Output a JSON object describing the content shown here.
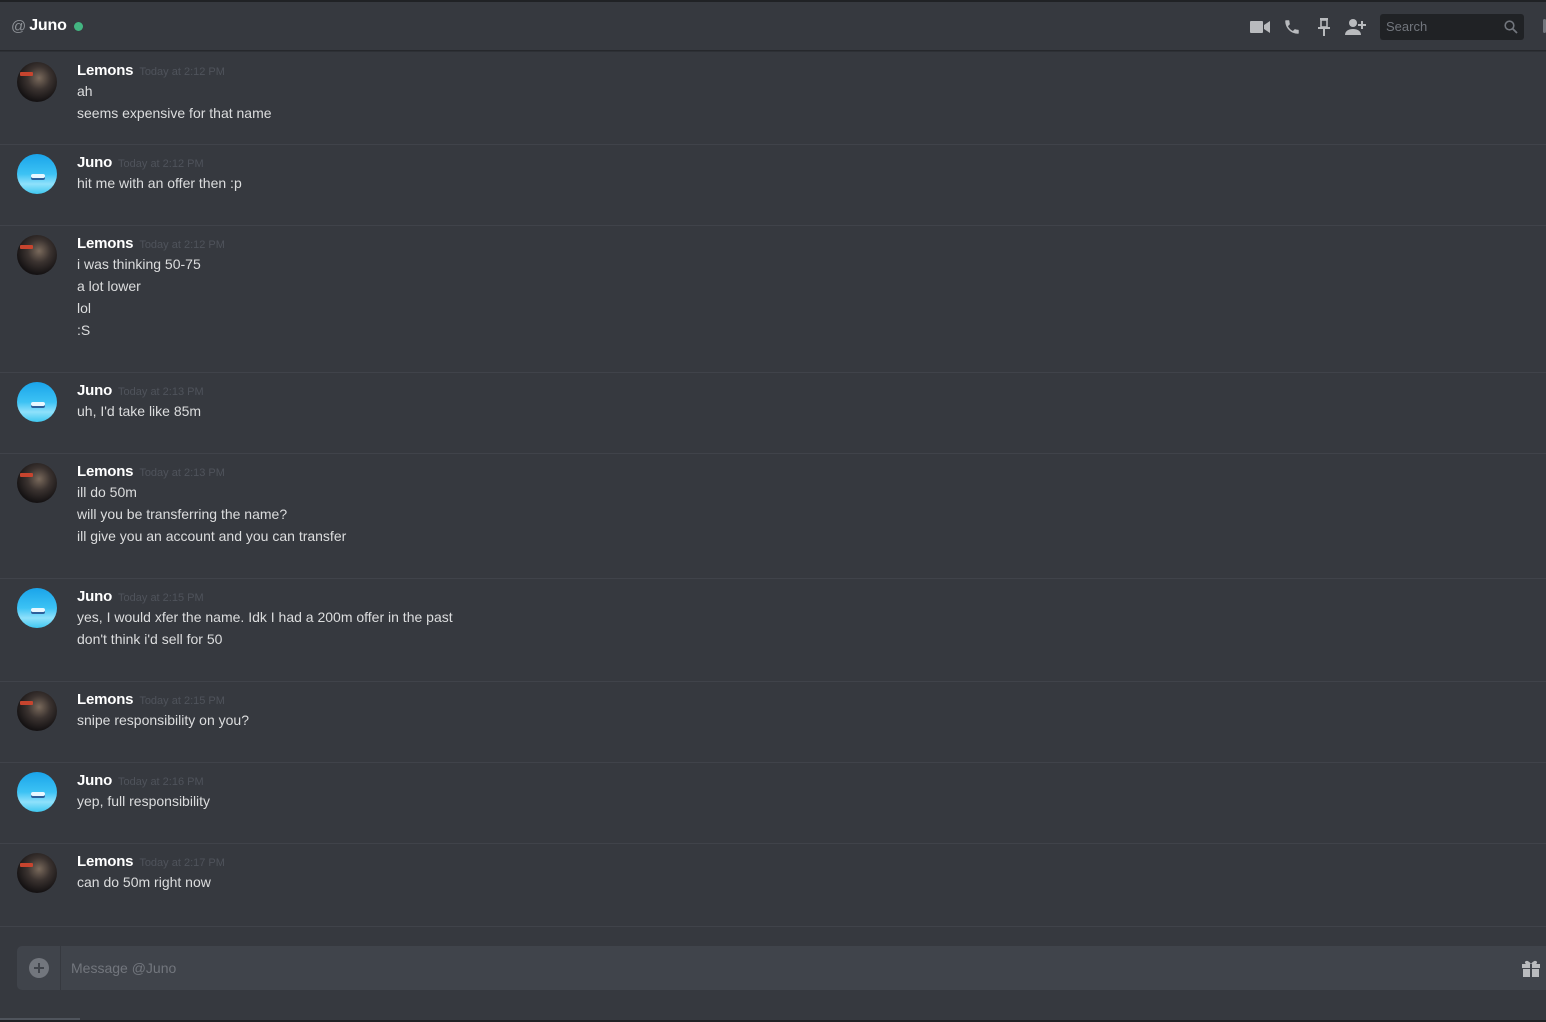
{
  "header": {
    "at_symbol": "@",
    "name": "Juno",
    "status": "online",
    "status_color": "#43b581",
    "icons": [
      "video-call-icon",
      "voice-call-icon",
      "pin-icon",
      "add-friend-icon"
    ],
    "search_placeholder": "Search"
  },
  "messages": [
    {
      "author": "Lemons",
      "avatar": "lemons-avatar",
      "timestamp": "Today at 2:12 PM",
      "lines": [
        "ah",
        "seems expensive for that name"
      ]
    },
    {
      "author": "Juno",
      "avatar": "juno-avatar",
      "timestamp": "Today at 2:12 PM",
      "lines": [
        "hit me with an offer then :p"
      ]
    },
    {
      "author": "Lemons",
      "avatar": "lemons-avatar",
      "timestamp": "Today at 2:12 PM",
      "lines": [
        "i was thinking 50-75",
        "a lot lower",
        "lol",
        ":S"
      ]
    },
    {
      "author": "Juno",
      "avatar": "juno-avatar",
      "timestamp": "Today at 2:13 PM",
      "lines": [
        "uh, I'd take like 85m"
      ]
    },
    {
      "author": "Lemons",
      "avatar": "lemons-avatar",
      "timestamp": "Today at 2:13 PM",
      "lines": [
        "ill do 50m",
        "will you be transferring the name?",
        "ill give you an account and you can transfer"
      ]
    },
    {
      "author": "Juno",
      "avatar": "juno-avatar",
      "timestamp": "Today at 2:15 PM",
      "lines": [
        "yes, I would xfer the name. Idk I had a 200m offer in the past",
        "don't think i'd sell for 50"
      ]
    },
    {
      "author": "Lemons",
      "avatar": "lemons-avatar",
      "timestamp": "Today at 2:15 PM",
      "lines": [
        "snipe responsibility on you?"
      ]
    },
    {
      "author": "Juno",
      "avatar": "juno-avatar",
      "timestamp": "Today at 2:16 PM",
      "lines": [
        "yep, full responsibility"
      ]
    },
    {
      "author": "Lemons",
      "avatar": "lemons-avatar",
      "timestamp": "Today at 2:17 PM",
      "lines": [
        "can do 50m right now"
      ]
    }
  ],
  "composer": {
    "placeholder": "Message @Juno",
    "value": "",
    "icons": [
      "add-attachment-icon",
      "gift-icon"
    ]
  },
  "colors": {
    "background": "#36393f",
    "input_background": "#40444b",
    "text": "#dcddde",
    "timestamp": "#4f535b"
  }
}
